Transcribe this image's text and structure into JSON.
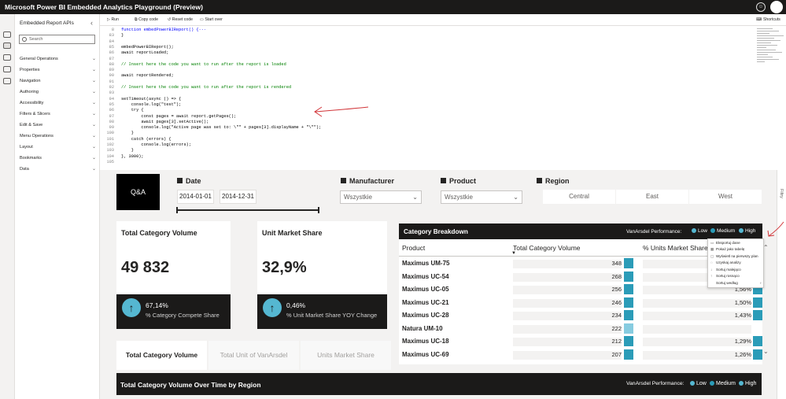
{
  "app": {
    "title": "Microsoft Power BI Embedded Analytics Playground (Preview)",
    "smiley_icon": "smiley-icon",
    "settings_icon": "gear-icon"
  },
  "sidebar": {
    "title": "Embedded Report APIs",
    "search_placeholder": "Search",
    "items": [
      {
        "label": "General Operations"
      },
      {
        "label": "Properties"
      },
      {
        "label": "Navigation"
      },
      {
        "label": "Authoring"
      },
      {
        "label": "Accessibility"
      },
      {
        "label": "Filters & Slicers"
      },
      {
        "label": "Edit & Save"
      },
      {
        "label": "Menu Operations"
      },
      {
        "label": "Layout"
      },
      {
        "label": "Bookmarks"
      },
      {
        "label": "Data"
      }
    ]
  },
  "toolbar": {
    "run": "Run",
    "copy": "Copy code",
    "reset": "Reset code",
    "start_over": "Start over",
    "shortcuts": "Shortcuts"
  },
  "code_lines": [
    {
      "n": "8",
      "t": "function embedPowerBIReport() {···",
      "c": "fn"
    },
    {
      "n": "83",
      "t": "}",
      "c": ""
    },
    {
      "n": "84",
      "t": "",
      "c": ""
    },
    {
      "n": "85",
      "t": "embedPowerBIReport();",
      "c": ""
    },
    {
      "n": "86",
      "t": "await reportLoaded;",
      "c": ""
    },
    {
      "n": "87",
      "t": "",
      "c": ""
    },
    {
      "n": "88",
      "t": "// Insert here the code you want to run after the report is loaded",
      "c": "cm"
    },
    {
      "n": "89",
      "t": "",
      "c": ""
    },
    {
      "n": "90",
      "t": "await reportRendered;",
      "c": ""
    },
    {
      "n": "91",
      "t": "",
      "c": ""
    },
    {
      "n": "92",
      "t": "// Insert here the code you want to run after the report is rendered",
      "c": "cm"
    },
    {
      "n": "93",
      "t": "",
      "c": ""
    },
    {
      "n": "94",
      "t": "setTimeout(async () => {",
      "c": ""
    },
    {
      "n": "95",
      "t": "    console.log(\"test\");",
      "c": ""
    },
    {
      "n": "96",
      "t": "    try {",
      "c": ""
    },
    {
      "n": "97",
      "t": "        const pages = await report.getPages();",
      "c": ""
    },
    {
      "n": "98",
      "t": "        await pages[3].setActive();",
      "c": ""
    },
    {
      "n": "99",
      "t": "        console.log(\"Active page was set to: \\\"\" + pages[3].displayName + \"\\\"\");",
      "c": ""
    },
    {
      "n": "100",
      "t": "    }",
      "c": ""
    },
    {
      "n": "101",
      "t": "    catch (errors) {",
      "c": ""
    },
    {
      "n": "102",
      "t": "        console.log(errors);",
      "c": ""
    },
    {
      "n": "103",
      "t": "    }",
      "c": ""
    },
    {
      "n": "104",
      "t": "}, 3000);",
      "c": ""
    },
    {
      "n": "105",
      "t": "",
      "c": ""
    }
  ],
  "report": {
    "qa_label": "Q&A",
    "date": {
      "title": "Date",
      "start": "2014-01-01",
      "end": "2014-12-31"
    },
    "manufacturer": {
      "title": "Manufacturer",
      "value": "Wszystkie"
    },
    "product": {
      "title": "Product",
      "value": "Wszystkie"
    },
    "region": {
      "title": "Region",
      "options": [
        "Central",
        "East",
        "West"
      ]
    },
    "filters_label": "Filtry",
    "cards": [
      {
        "title": "Total Category Volume",
        "value": "49 832",
        "kpi_value": "67,14%",
        "kpi_label": "% Category Compete Share"
      },
      {
        "title": "Unit Market Share",
        "value": "32,9%",
        "kpi_value": "0,46%",
        "kpi_label": "% Unit Market Share YOY Change"
      }
    ],
    "kpi_arrow": "↑",
    "tabs": [
      "Total Category Volume",
      "Total Unit of VanArsdel",
      "Units Market Share"
    ],
    "breakdown": {
      "title": "Category Breakdown",
      "perf_label": "VanArsdel Performance:",
      "legend": [
        {
          "name": "Low",
          "color": "#55b7d1"
        },
        {
          "name": "Medium",
          "color": "#2b9cb8"
        },
        {
          "name": "High",
          "color": "#55b7d1"
        }
      ],
      "col_product": "Product",
      "col_volume": "Total Category Volume",
      "col_share": "% Units Market Share",
      "rows": [
        {
          "product": "Maximus UM-75",
          "volume": "348",
          "share": ""
        },
        {
          "product": "Maximus UC-54",
          "volume": "268",
          "share": ""
        },
        {
          "product": "Maximus UC-05",
          "volume": "256",
          "share": "1,56%"
        },
        {
          "product": "Maximus UC-21",
          "volume": "246",
          "share": "1,50%"
        },
        {
          "product": "Maximus UC-28",
          "volume": "234",
          "share": "1,43%"
        },
        {
          "product": "Natura UM-10",
          "volume": "222",
          "share": ""
        },
        {
          "product": "Maximus UC-18",
          "volume": "212",
          "share": "1,29%"
        },
        {
          "product": "Maximus UC-69",
          "volume": "207",
          "share": "1,26%"
        }
      ]
    },
    "context_menu": [
      "Eksportuj dane",
      "Pokaż jako tabelę",
      "Wyświetl na pierwszy plan",
      "Uzyskaj analizy",
      "Sortuj malejąco",
      "Sortuj rosnąco",
      "Sortuj według"
    ],
    "bottom": {
      "title": "Total Category Volume Over Time by Region",
      "perf_label": "VanArsdel Performance:",
      "legend": [
        "Low",
        "Medium",
        "High"
      ]
    }
  }
}
